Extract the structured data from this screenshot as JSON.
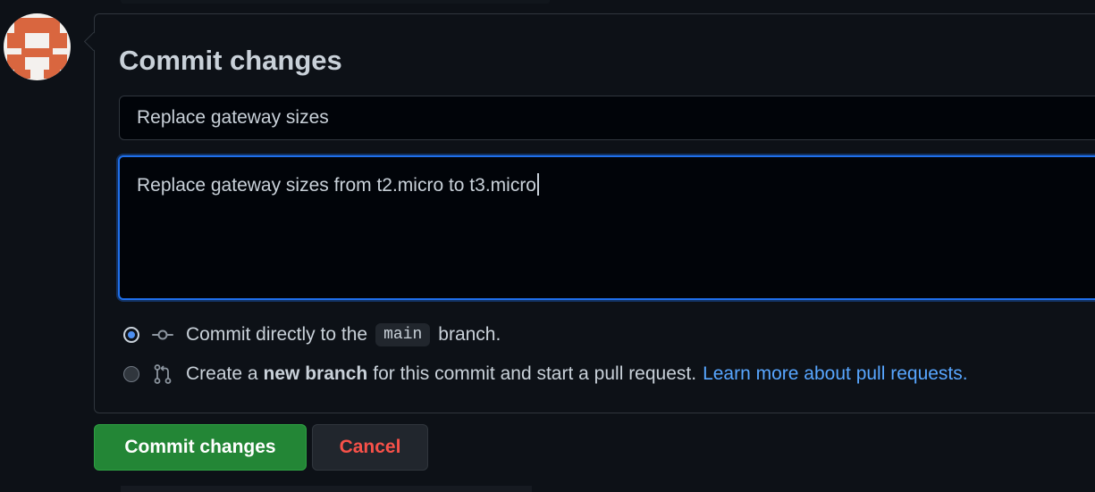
{
  "dialog": {
    "title": "Commit changes"
  },
  "summary": {
    "value": "Replace gateway sizes"
  },
  "description": {
    "value": "Replace gateway sizes from t2.micro to t3.micro"
  },
  "options": {
    "direct": {
      "prefix": "Commit directly to the",
      "branch": "main",
      "suffix": "branch.",
      "selected": true,
      "icon": "git-commit-icon"
    },
    "new_branch": {
      "prefix": "Create a",
      "bold": "new branch",
      "suffix": "for this commit and start a pull request.",
      "link": "Learn more about pull requests.",
      "selected": false,
      "icon": "git-pull-request-icon"
    }
  },
  "buttons": {
    "commit_label": "Commit changes",
    "cancel_label": "Cancel"
  },
  "colors": {
    "accent_blue": "#1f6feb",
    "link": "#58a6ff",
    "primary_button": "#238636",
    "danger_text": "#f85149",
    "avatar_brand": "#d9663f"
  }
}
